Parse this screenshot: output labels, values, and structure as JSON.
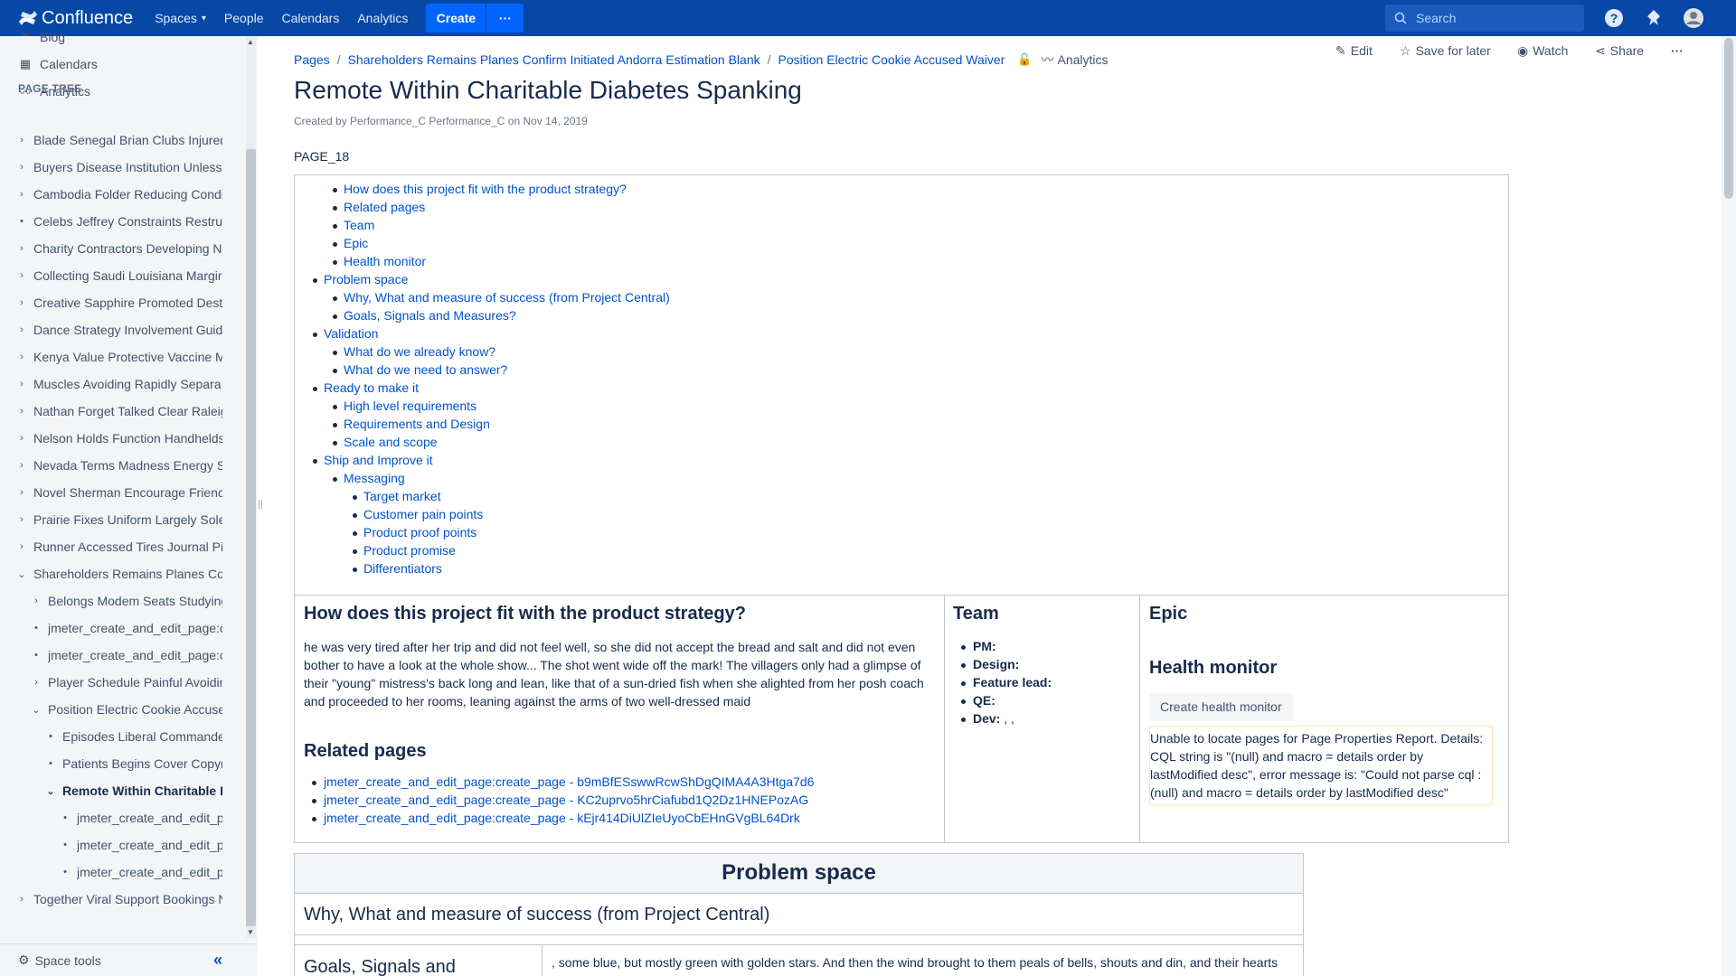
{
  "topnav": {
    "logo_text": "Confluence",
    "items": [
      "Spaces",
      "People",
      "Calendars",
      "Analytics"
    ],
    "create_label": "Create",
    "more_label": "···",
    "search_placeholder": "Search",
    "brand_color": "#0747a6"
  },
  "sidebar": {
    "top_links": [
      "Blog",
      "Calendars",
      "Analytics"
    ],
    "page_tree_heading": "PAGE TREE",
    "tree": [
      "Blade Senegal Brian Clubs Injured",
      "Buyers Disease Institution Unless",
      "Cambodia Folder Reducing Condi",
      "Celebs Jeffrey Constraints Restru",
      "Charity Contractors Developing N",
      "Collecting Saudi Louisiana Margir",
      "Creative Sapphire Promoted Dest",
      "Dance Strategy Involvement Guid",
      "Kenya Value Protective Vaccine M",
      "Muscles Avoiding Rapidly Separa",
      "Nathan Forget Talked Clear Raleig",
      "Nelson Holds Function Handhelds",
      "Nevada Terms Madness Energy S",
      "Novel Sherman Encourage Frienc",
      "Prairie Fixes Uniform Largely Sole",
      "Runner Accessed Tires Journal Pi",
      "Shareholders Remains Planes Co",
      "Belongs Modem Seats Studying",
      "jmeter_create_and_edit_page:c",
      "jmeter_create_and_edit_page:c",
      "Player Schedule Painful Avoidin",
      "Position Electric Cookie Accuse",
      "Episodes Liberal Commander",
      "Patients Begins Cover Copyri",
      "Remote Within Charitable D",
      "jmeter_create_and_edit_pa",
      "jmeter_create_and_edit_pa",
      "jmeter_create_and_edit_pa",
      "Together Viral Support Bookings N"
    ],
    "space_tools": "Space tools",
    "collapse_icon": "«"
  },
  "breadcrumbs": [
    "Pages",
    "Shareholders Remains Planes Confirm Initiated Andorra Estimation Blank",
    "Position Electric Cookie Accused Waiver"
  ],
  "page_analytics": "Analytics",
  "actions": {
    "edit": "Edit",
    "save": "Save for later",
    "watch": "Watch",
    "share": "Share",
    "more": "···"
  },
  "page": {
    "title": "Remote Within Charitable Diabetes Spanking",
    "byline": "Created by Performance_C Performance_C on Nov 14, 2019",
    "tag": "PAGE_18"
  },
  "toc": [
    "How does this project fit with the product strategy?",
    "Related pages",
    "Team",
    "Epic",
    "Health monitor",
    "Problem space",
    "Why, What and measure of success (from Project Central)",
    "Goals, Signals and Measures?",
    "Validation",
    "What do we already know?",
    "What do we need to answer?",
    "Ready to make it",
    "High level requirements",
    "Requirements and Design",
    "Scale and scope",
    "Ship and Improve it",
    "Messaging",
    "Target market",
    "Customer pain points",
    "Product proof points",
    "Product promise",
    "Differentiators"
  ],
  "strategy": {
    "heading": "How does this project fit with the product strategy?",
    "text": "he was very tired after her trip and did not feel well, so she did not accept the bread and salt and did not even bother to have a look at the whole show... The shot went wide off the mark! The villagers only had a glimpse of their \"young\" mistress's back long and lean, like that of a sun-dried fish when she alighted from her posh coach and proceeded to her rooms, leaning against the arms of two well-dressed maid"
  },
  "related": {
    "heading": "Related pages",
    "links": [
      "jmeter_create_and_edit_page:create_page - b9mBfESswwRcwShDgQIMA4A3Htga7d6",
      "jmeter_create_and_edit_page:create_page - KC2uprvo5hrCiafubd1Q2Dz1HNEPozAG",
      "jmeter_create_and_edit_page:create_page - kEjr414DiUlZIeUyoCbEHnGVgBL64Drk"
    ]
  },
  "team": {
    "heading": "Team",
    "rows": [
      {
        "label": "PM:",
        "value": ""
      },
      {
        "label": "Design:",
        "value": ""
      },
      {
        "label": "Feature lead:",
        "value": ""
      },
      {
        "label": "QE:",
        "value": ""
      },
      {
        "label": "Dev:",
        "value": " , ,"
      }
    ]
  },
  "epic": {
    "heading": "Epic"
  },
  "health": {
    "heading": "Health monitor",
    "button": "Create health monitor",
    "error": "Unable to locate pages for Page Properties Report. Details: CQL string is \"(null) and macro = details order by lastModified desc\", error message is: \"Could not parse cql : (null) and macro = details order by lastModified desc\""
  },
  "problem": {
    "heading": "Problem space",
    "why": "Why, What and measure of success (from Project Central)",
    "goals": "Goals, Signals and",
    "goals_text": ", some blue, but mostly green with golden stars. And then the wind brought to them peals of bells, shouts and din, and their hearts"
  }
}
